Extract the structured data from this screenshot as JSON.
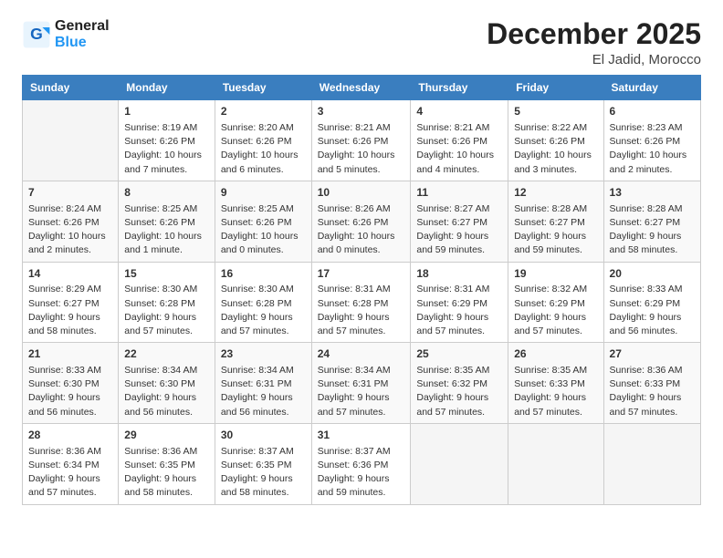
{
  "logo": {
    "line1": "General",
    "line2": "Blue"
  },
  "title": "December 2025",
  "location": "El Jadid, Morocco",
  "weekdays": [
    "Sunday",
    "Monday",
    "Tuesday",
    "Wednesday",
    "Thursday",
    "Friday",
    "Saturday"
  ],
  "weeks": [
    [
      {
        "day": "",
        "info": ""
      },
      {
        "day": "1",
        "info": "Sunrise: 8:19 AM\nSunset: 6:26 PM\nDaylight: 10 hours\nand 7 minutes."
      },
      {
        "day": "2",
        "info": "Sunrise: 8:20 AM\nSunset: 6:26 PM\nDaylight: 10 hours\nand 6 minutes."
      },
      {
        "day": "3",
        "info": "Sunrise: 8:21 AM\nSunset: 6:26 PM\nDaylight: 10 hours\nand 5 minutes."
      },
      {
        "day": "4",
        "info": "Sunrise: 8:21 AM\nSunset: 6:26 PM\nDaylight: 10 hours\nand 4 minutes."
      },
      {
        "day": "5",
        "info": "Sunrise: 8:22 AM\nSunset: 6:26 PM\nDaylight: 10 hours\nand 3 minutes."
      },
      {
        "day": "6",
        "info": "Sunrise: 8:23 AM\nSunset: 6:26 PM\nDaylight: 10 hours\nand 2 minutes."
      }
    ],
    [
      {
        "day": "7",
        "info": "Sunrise: 8:24 AM\nSunset: 6:26 PM\nDaylight: 10 hours\nand 2 minutes."
      },
      {
        "day": "8",
        "info": "Sunrise: 8:25 AM\nSunset: 6:26 PM\nDaylight: 10 hours\nand 1 minute."
      },
      {
        "day": "9",
        "info": "Sunrise: 8:25 AM\nSunset: 6:26 PM\nDaylight: 10 hours\nand 0 minutes."
      },
      {
        "day": "10",
        "info": "Sunrise: 8:26 AM\nSunset: 6:26 PM\nDaylight: 10 hours\nand 0 minutes."
      },
      {
        "day": "11",
        "info": "Sunrise: 8:27 AM\nSunset: 6:27 PM\nDaylight: 9 hours\nand 59 minutes."
      },
      {
        "day": "12",
        "info": "Sunrise: 8:28 AM\nSunset: 6:27 PM\nDaylight: 9 hours\nand 59 minutes."
      },
      {
        "day": "13",
        "info": "Sunrise: 8:28 AM\nSunset: 6:27 PM\nDaylight: 9 hours\nand 58 minutes."
      }
    ],
    [
      {
        "day": "14",
        "info": "Sunrise: 8:29 AM\nSunset: 6:27 PM\nDaylight: 9 hours\nand 58 minutes."
      },
      {
        "day": "15",
        "info": "Sunrise: 8:30 AM\nSunset: 6:28 PM\nDaylight: 9 hours\nand 57 minutes."
      },
      {
        "day": "16",
        "info": "Sunrise: 8:30 AM\nSunset: 6:28 PM\nDaylight: 9 hours\nand 57 minutes."
      },
      {
        "day": "17",
        "info": "Sunrise: 8:31 AM\nSunset: 6:28 PM\nDaylight: 9 hours\nand 57 minutes."
      },
      {
        "day": "18",
        "info": "Sunrise: 8:31 AM\nSunset: 6:29 PM\nDaylight: 9 hours\nand 57 minutes."
      },
      {
        "day": "19",
        "info": "Sunrise: 8:32 AM\nSunset: 6:29 PM\nDaylight: 9 hours\nand 57 minutes."
      },
      {
        "day": "20",
        "info": "Sunrise: 8:33 AM\nSunset: 6:29 PM\nDaylight: 9 hours\nand 56 minutes."
      }
    ],
    [
      {
        "day": "21",
        "info": "Sunrise: 8:33 AM\nSunset: 6:30 PM\nDaylight: 9 hours\nand 56 minutes."
      },
      {
        "day": "22",
        "info": "Sunrise: 8:34 AM\nSunset: 6:30 PM\nDaylight: 9 hours\nand 56 minutes."
      },
      {
        "day": "23",
        "info": "Sunrise: 8:34 AM\nSunset: 6:31 PM\nDaylight: 9 hours\nand 56 minutes."
      },
      {
        "day": "24",
        "info": "Sunrise: 8:34 AM\nSunset: 6:31 PM\nDaylight: 9 hours\nand 57 minutes."
      },
      {
        "day": "25",
        "info": "Sunrise: 8:35 AM\nSunset: 6:32 PM\nDaylight: 9 hours\nand 57 minutes."
      },
      {
        "day": "26",
        "info": "Sunrise: 8:35 AM\nSunset: 6:33 PM\nDaylight: 9 hours\nand 57 minutes."
      },
      {
        "day": "27",
        "info": "Sunrise: 8:36 AM\nSunset: 6:33 PM\nDaylight: 9 hours\nand 57 minutes."
      }
    ],
    [
      {
        "day": "28",
        "info": "Sunrise: 8:36 AM\nSunset: 6:34 PM\nDaylight: 9 hours\nand 57 minutes."
      },
      {
        "day": "29",
        "info": "Sunrise: 8:36 AM\nSunset: 6:35 PM\nDaylight: 9 hours\nand 58 minutes."
      },
      {
        "day": "30",
        "info": "Sunrise: 8:37 AM\nSunset: 6:35 PM\nDaylight: 9 hours\nand 58 minutes."
      },
      {
        "day": "31",
        "info": "Sunrise: 8:37 AM\nSunset: 6:36 PM\nDaylight: 9 hours\nand 59 minutes."
      },
      {
        "day": "",
        "info": ""
      },
      {
        "day": "",
        "info": ""
      },
      {
        "day": "",
        "info": ""
      }
    ]
  ]
}
